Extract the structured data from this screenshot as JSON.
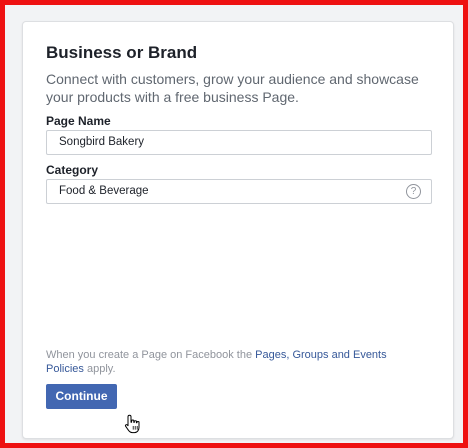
{
  "card": {
    "title": "Business or Brand",
    "description": "Connect with customers, grow your audience and showcase your products with a free business Page."
  },
  "form": {
    "page_name": {
      "label": "Page Name",
      "value": "Songbird Bakery"
    },
    "category": {
      "label": "Category",
      "value": "Food & Beverage",
      "help_icon": "question-icon",
      "help_glyph": "?"
    }
  },
  "policy": {
    "prefix": "When you create a Page on Facebook the ",
    "link": "Pages, Groups and Events Policies",
    "suffix": " apply."
  },
  "actions": {
    "continue_label": "Continue"
  },
  "cursor": {
    "icon": "hand-pointer-icon"
  },
  "colors": {
    "frame_border": "#ee1111",
    "primary_button": "#4267b2",
    "link": "#365899"
  }
}
